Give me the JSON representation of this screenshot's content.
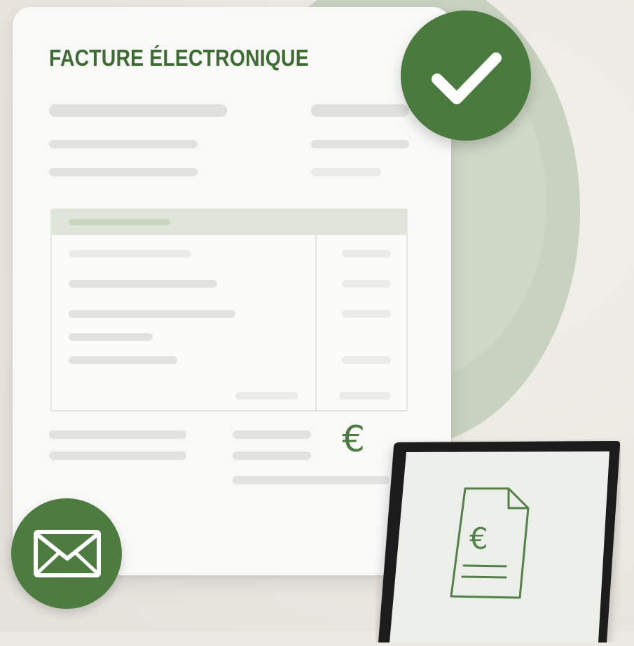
{
  "invoice": {
    "title": "FACTURE ÉLECTRONIQUE",
    "currency_symbol": "€"
  },
  "badges": {
    "check": {
      "icon": "checkmark-icon",
      "color": "#4b7a3f"
    },
    "mail": {
      "icon": "envelope-icon",
      "color": "#4d7b40"
    }
  },
  "laptop": {
    "document_icon": "euro-document-icon",
    "currency_symbol": "€"
  },
  "colors": {
    "accent_green": "#3e6b34",
    "background_circle": "#c9d2c0",
    "paper": "#f9f9f8"
  }
}
